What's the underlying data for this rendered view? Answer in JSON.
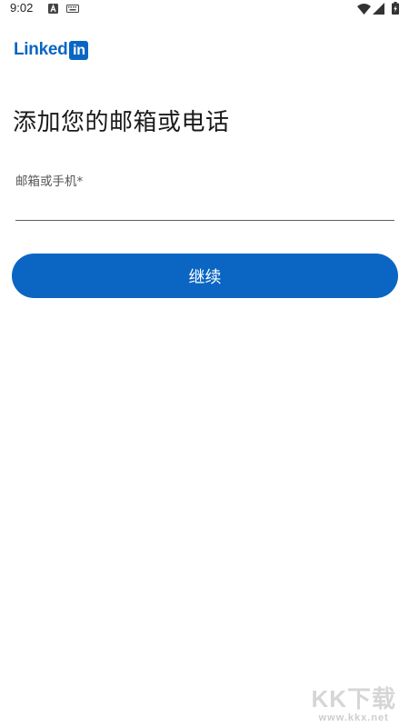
{
  "status_bar": {
    "time": "9:02"
  },
  "icons": {
    "notification": "a-letter-icon",
    "keyboard": "keyboard-icon",
    "wifi": "wifi-icon",
    "signal": "signal-icon",
    "battery": "battery-charging-icon"
  },
  "brand": {
    "logo_text": "Linked",
    "logo_in": "in",
    "color": "#0a66c2"
  },
  "page": {
    "title": "添加您的邮箱或电话"
  },
  "form": {
    "field_label": "邮箱或手机*",
    "field_value": "",
    "continue_label": "继续"
  },
  "watermark": {
    "main": "KK下载",
    "url": "www.kkx.net"
  }
}
